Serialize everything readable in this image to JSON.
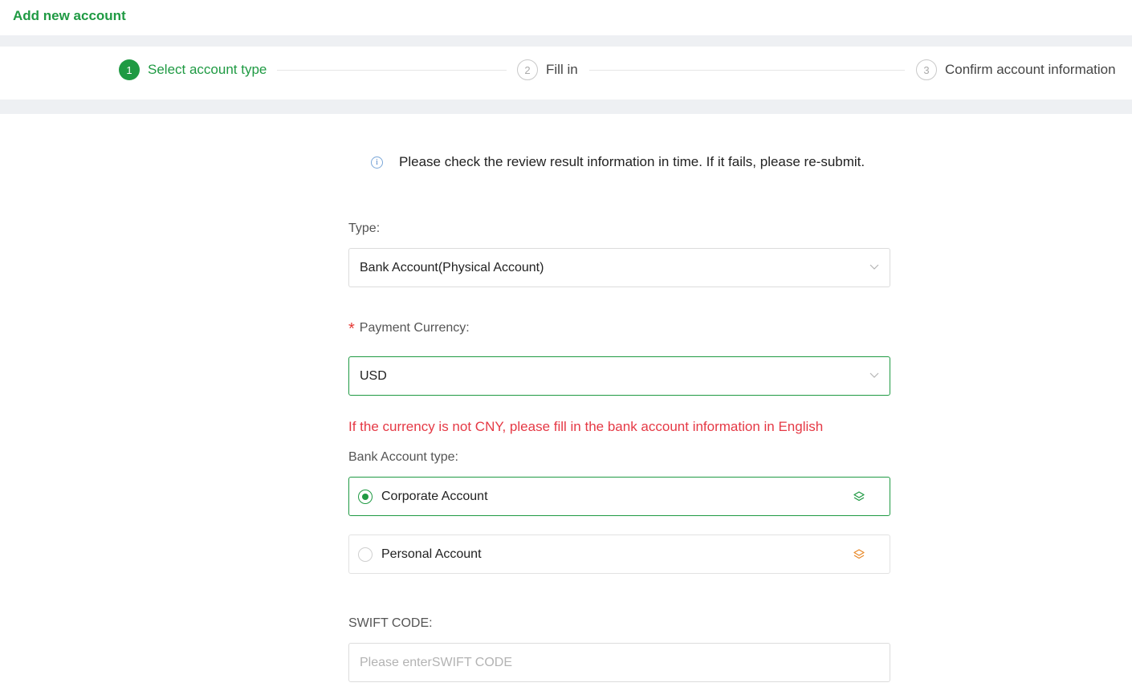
{
  "header": {
    "title": "Add new account"
  },
  "steps": [
    {
      "number": "1",
      "label": "Select account type",
      "state": "active"
    },
    {
      "number": "2",
      "label": "Fill in",
      "state": "pending"
    },
    {
      "number": "3",
      "label": "Confirm account information",
      "state": "pending"
    }
  ],
  "notice": {
    "icon": "info-icon",
    "text": "Please check the review result information in time. If it fails, please re-submit."
  },
  "type_field": {
    "label": "Type:",
    "value": "Bank Account(Physical Account)"
  },
  "currency_field": {
    "required_mark": "*",
    "label": "Payment Currency:",
    "value": "USD"
  },
  "warning": "If the currency is not CNY, please fill in the bank account information in English",
  "bank_account_type": {
    "label": "Bank Account type:",
    "options": [
      {
        "label": "Corporate Account",
        "selected": true,
        "icon": "layers-icon",
        "icon_color": "#1f9a43"
      },
      {
        "label": "Personal Account",
        "selected": false,
        "icon": "layers-icon",
        "icon_color": "#e8892a"
      }
    ]
  },
  "swift_field": {
    "label": "SWIFT CODE:",
    "placeholder": "Please enterSWIFT CODE",
    "value": ""
  },
  "colors": {
    "accent": "#1f9a43",
    "error": "#e53945",
    "personal_icon": "#e8892a"
  }
}
